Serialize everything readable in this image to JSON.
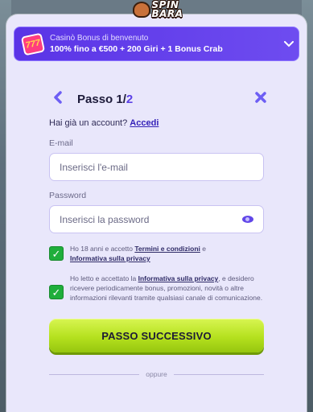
{
  "logo": {
    "line1": "SPIN",
    "line2": "BARA"
  },
  "bonus": {
    "icon_text": "777",
    "title": "Casinò Bonus di benvenuto",
    "subtitle": "100% fino a €500 + 200 Giri + 1 Bonus Crab"
  },
  "step": {
    "label": "Passo 1/",
    "total": "2"
  },
  "account": {
    "question": "Hai già un account?",
    "login_link": "Accedi"
  },
  "email": {
    "label": "E-mail",
    "placeholder": "Inserisci l'e-mail"
  },
  "password": {
    "label": "Password",
    "placeholder": "Inserisci la password"
  },
  "consent1": {
    "prefix": "Ho 18 anni e accetto ",
    "link1": "Termini e condizioni",
    "mid": " e",
    "link2": "Informativa sulla privacy"
  },
  "consent2": {
    "prefix": "Ho letto e accettato la ",
    "link": "Informativa sulla privacy",
    "suffix": ", e desidero ricevere periodicamente bonus, promozioni, novità o altre informazioni rilevanti tramite qualsiasi canale di comunicazione."
  },
  "cta": {
    "label": "PASSO SUCCESSIVO"
  },
  "divider": {
    "label": "oppure"
  }
}
